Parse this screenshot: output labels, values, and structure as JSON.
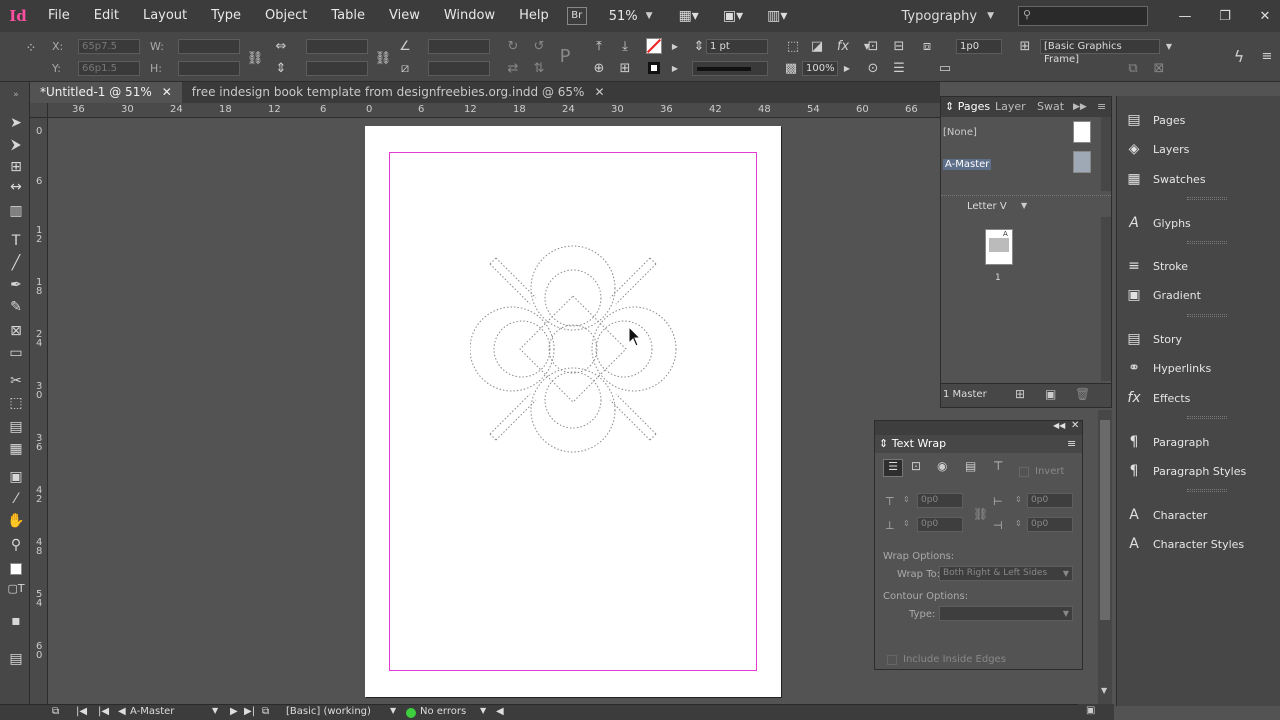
{
  "app": {
    "logo": "Id"
  },
  "menu": [
    "File",
    "Edit",
    "Layout",
    "Type",
    "Object",
    "Table",
    "View",
    "Window",
    "Help"
  ],
  "menubar": {
    "bridge": "Br",
    "zoom": "51%",
    "workspace": "Typography"
  },
  "control": {
    "x_label": "X:",
    "x_value": "65p7.5",
    "y_label": "Y:",
    "y_value": "66p1.5",
    "w_label": "W:",
    "h_label": "H:",
    "stroke_weight": "1 pt",
    "gap_value": "1p0",
    "opacity": "100%",
    "object_style": "[Basic Graphics Frame]"
  },
  "tabs": [
    {
      "label": "*Untitled-1 @ 51%",
      "active": true
    },
    {
      "label": "free indesign book template from designfreebies.org.indd @ 65%",
      "active": false
    }
  ],
  "ruler": {
    "top": [
      "36",
      "30",
      "24",
      "18",
      "12",
      "6",
      "0",
      "6",
      "12",
      "18",
      "24",
      "30",
      "36",
      "42",
      "48",
      "54",
      "60",
      "66"
    ],
    "left": [
      "0",
      "6",
      "1 2",
      "1 8",
      "2 4",
      "3 0",
      "3 6",
      "4 2",
      "4 8",
      "5 4",
      "6 0"
    ]
  },
  "pages_panel": {
    "tabs": [
      "Pages",
      "Layer",
      "Swat"
    ],
    "none_label": "[None]",
    "master_label": "A-Master",
    "page_size": "Letter V",
    "thumb_prefix": "A",
    "page_number": "1",
    "footer": "1 Master"
  },
  "text_wrap": {
    "title": "Text Wrap",
    "invert": "Invert",
    "top_offset": "0p0",
    "left_offset": "0p0",
    "bottom_offset": "0p0",
    "right_offset": "0p0",
    "wrap_options": "Wrap Options:",
    "wrap_to_label": "Wrap To:",
    "wrap_to_value": "Both Right & Left Sides",
    "contour_options": "Contour Options:",
    "type_label": "Type:",
    "include_inside": "Include Inside Edges"
  },
  "dock": [
    {
      "label": "Pages",
      "icon": "pages-icon",
      "glyph": "▤"
    },
    {
      "label": "Layers",
      "icon": "layers-icon",
      "glyph": "◈"
    },
    {
      "label": "Swatches",
      "icon": "swatches-icon",
      "glyph": "▦"
    },
    {
      "label": "Glyphs",
      "icon": "glyphs-icon",
      "glyph": "A"
    },
    {
      "label": "Stroke",
      "icon": "stroke-icon",
      "glyph": "≡"
    },
    {
      "label": "Gradient",
      "icon": "gradient-icon",
      "glyph": "▣"
    },
    {
      "label": "Story",
      "icon": "story-icon",
      "glyph": "▤"
    },
    {
      "label": "Hyperlinks",
      "icon": "hyperlinks-icon",
      "glyph": "⚭"
    },
    {
      "label": "Effects",
      "icon": "effects-icon",
      "glyph": "fx"
    },
    {
      "label": "Paragraph",
      "icon": "paragraph-icon",
      "glyph": "¶"
    },
    {
      "label": "Paragraph Styles",
      "icon": "paragraph-styles-icon",
      "glyph": "¶"
    },
    {
      "label": "Character",
      "icon": "character-icon",
      "glyph": "A"
    },
    {
      "label": "Character Styles",
      "icon": "character-styles-icon",
      "glyph": "A"
    }
  ],
  "status": {
    "page_select": "A-Master",
    "profile": "[Basic] (working)",
    "preflight": "No errors"
  },
  "colors": {
    "accent_pink": "#e23ad3",
    "page": "#ffffff",
    "pasteboard": "#535353",
    "ok_green": "#3ecf3e"
  }
}
